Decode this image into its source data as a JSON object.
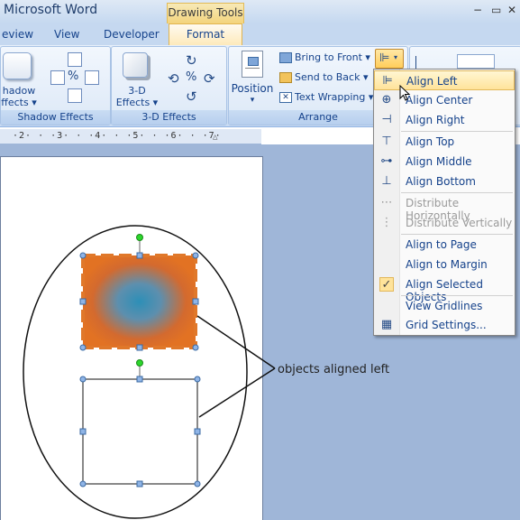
{
  "window": {
    "app_title": "Microsoft Word",
    "context_tab": "Drawing Tools"
  },
  "tabs": {
    "review": "eview",
    "view": "View",
    "developer": "Developer",
    "format": "Format"
  },
  "ribbon": {
    "shadow_effects": {
      "btn_line1": "hadow",
      "btn_line2": "ffects ▾",
      "label": "Shadow Effects"
    },
    "three_d_effects": {
      "btn_line1": "3-D",
      "btn_line2": "Effects ▾",
      "label": "3-D Effects"
    },
    "arrange": {
      "position": "Position",
      "position_arrow": "▾",
      "bring_to_front": "Bring to Front ▾",
      "send_to_back": "Send to Back ▾",
      "text_wrapping": "Text Wrapping ▾",
      "label": "Arrange"
    }
  },
  "ruler": {
    "text": "·2·  ·  ·3·  ·  ·4·  ·  ·5·  ·  ·6·  ·  ·7·"
  },
  "menu": {
    "items": [
      {
        "label": "Align Left",
        "icon": "align-left-icon"
      },
      {
        "label": "Align Center",
        "icon": "align-center-icon"
      },
      {
        "label": "Align Right",
        "icon": "align-right-icon"
      },
      {
        "label": "Align Top",
        "icon": "align-top-icon"
      },
      {
        "label": "Align Middle",
        "icon": "align-middle-icon"
      },
      {
        "label": "Align Bottom",
        "icon": "align-bottom-icon"
      },
      {
        "label": "Distribute Horizontally",
        "icon": "distribute-horizontal-icon"
      },
      {
        "label": "Distribute Vertically",
        "icon": "distribute-vertical-icon"
      },
      {
        "label": "Align to Page",
        "icon": ""
      },
      {
        "label": "Align to Margin",
        "icon": ""
      },
      {
        "label": "Align Selected Objects",
        "icon": "checkmark-icon"
      },
      {
        "label": "View Gridlines",
        "icon": ""
      },
      {
        "label": "Grid Settings...",
        "icon": "grid-icon"
      }
    ]
  },
  "document": {
    "callout_text": "objects aligned left"
  },
  "colors": {
    "accent_orange": "#e0782a",
    "gradient_blue": "#3d8fb3",
    "menu_hover": "#ffe39a"
  }
}
